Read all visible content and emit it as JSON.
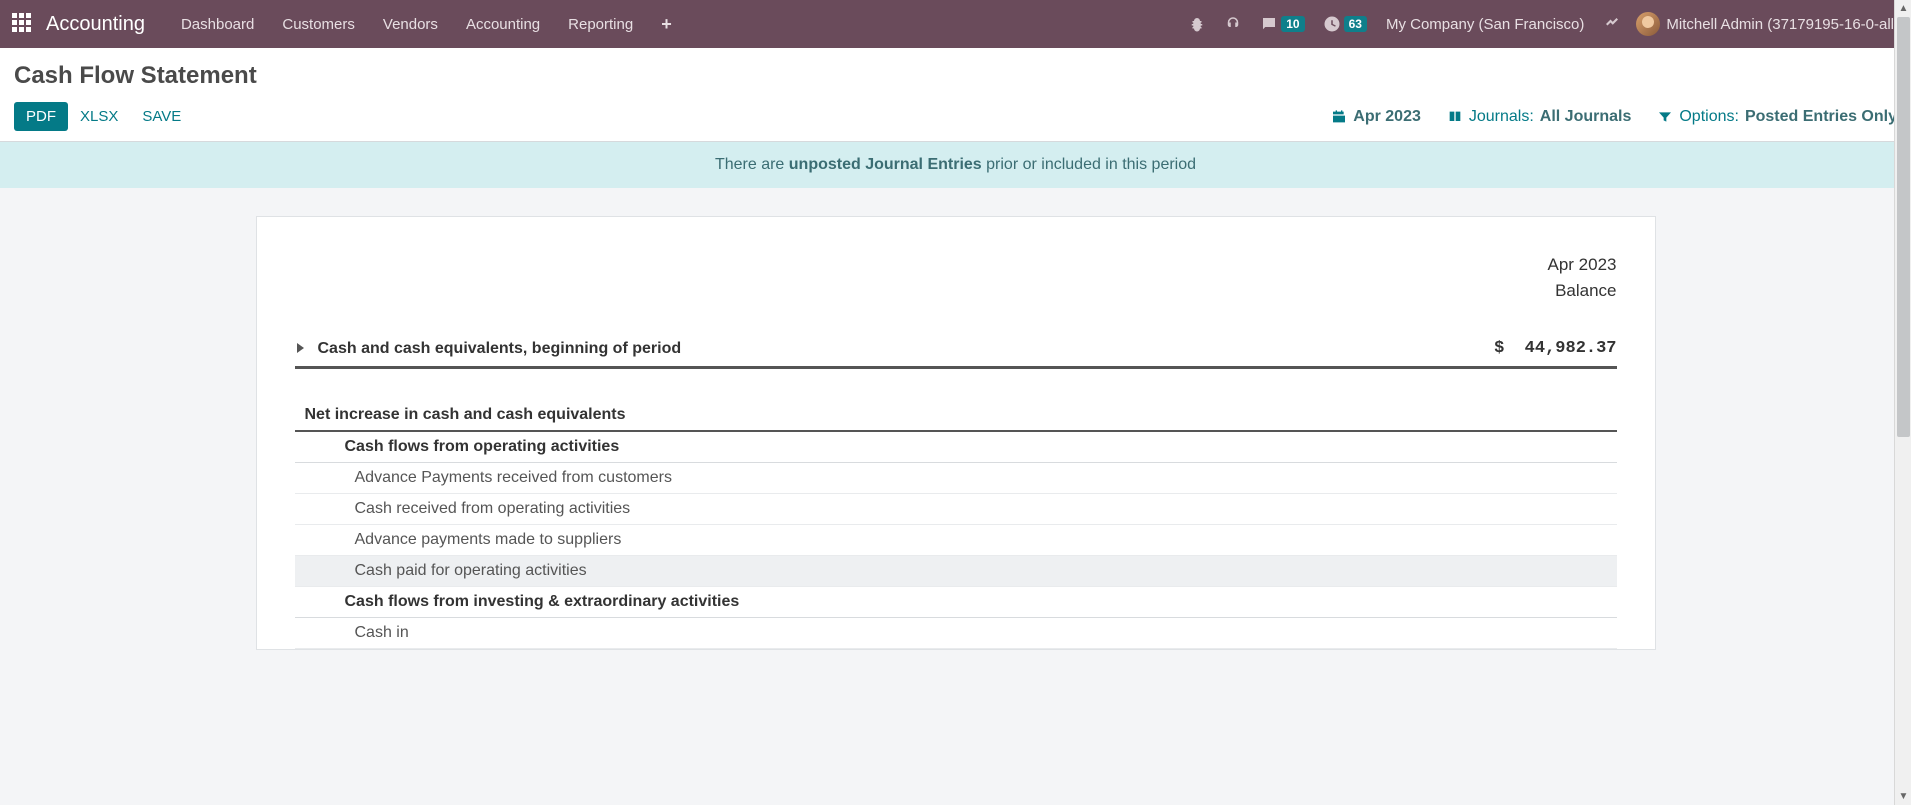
{
  "topbar": {
    "brand": "Accounting",
    "nav": [
      "Dashboard",
      "Customers",
      "Vendors",
      "Accounting",
      "Reporting"
    ],
    "messages_count": "10",
    "activities_count": "63",
    "company": "My Company (San Francisco)",
    "user": "Mitchell Admin (37179195-16-0-all)"
  },
  "page": {
    "title": "Cash Flow Statement",
    "buttons": {
      "pdf": "PDF",
      "xlsx": "XLSX",
      "save": "SAVE"
    },
    "filters": {
      "period": "Apr 2023",
      "journals_label": "Journals:",
      "journals_value": "All Journals",
      "options_label": "Options:",
      "options_value": "Posted Entries Only"
    }
  },
  "banner": {
    "pre": "There are ",
    "bold": "unposted Journal Entries",
    "post": " prior or included in this period"
  },
  "report": {
    "period": "Apr 2023",
    "balance_label": "Balance",
    "rows": {
      "r0": {
        "label": "Cash and cash equivalents, beginning of period",
        "value": "$  44,982.37"
      },
      "r1": {
        "label": "Net increase in cash and cash equivalents"
      },
      "r2": {
        "label": "Cash flows from operating activities"
      },
      "r3": {
        "label": "Advance Payments received from customers"
      },
      "r4": {
        "label": "Cash received from operating activities"
      },
      "r5": {
        "label": "Advance payments made to suppliers"
      },
      "r6": {
        "label": "Cash paid for operating activities"
      },
      "r7": {
        "label": "Cash flows from investing & extraordinary activities"
      },
      "r8": {
        "label": "Cash in"
      }
    }
  }
}
